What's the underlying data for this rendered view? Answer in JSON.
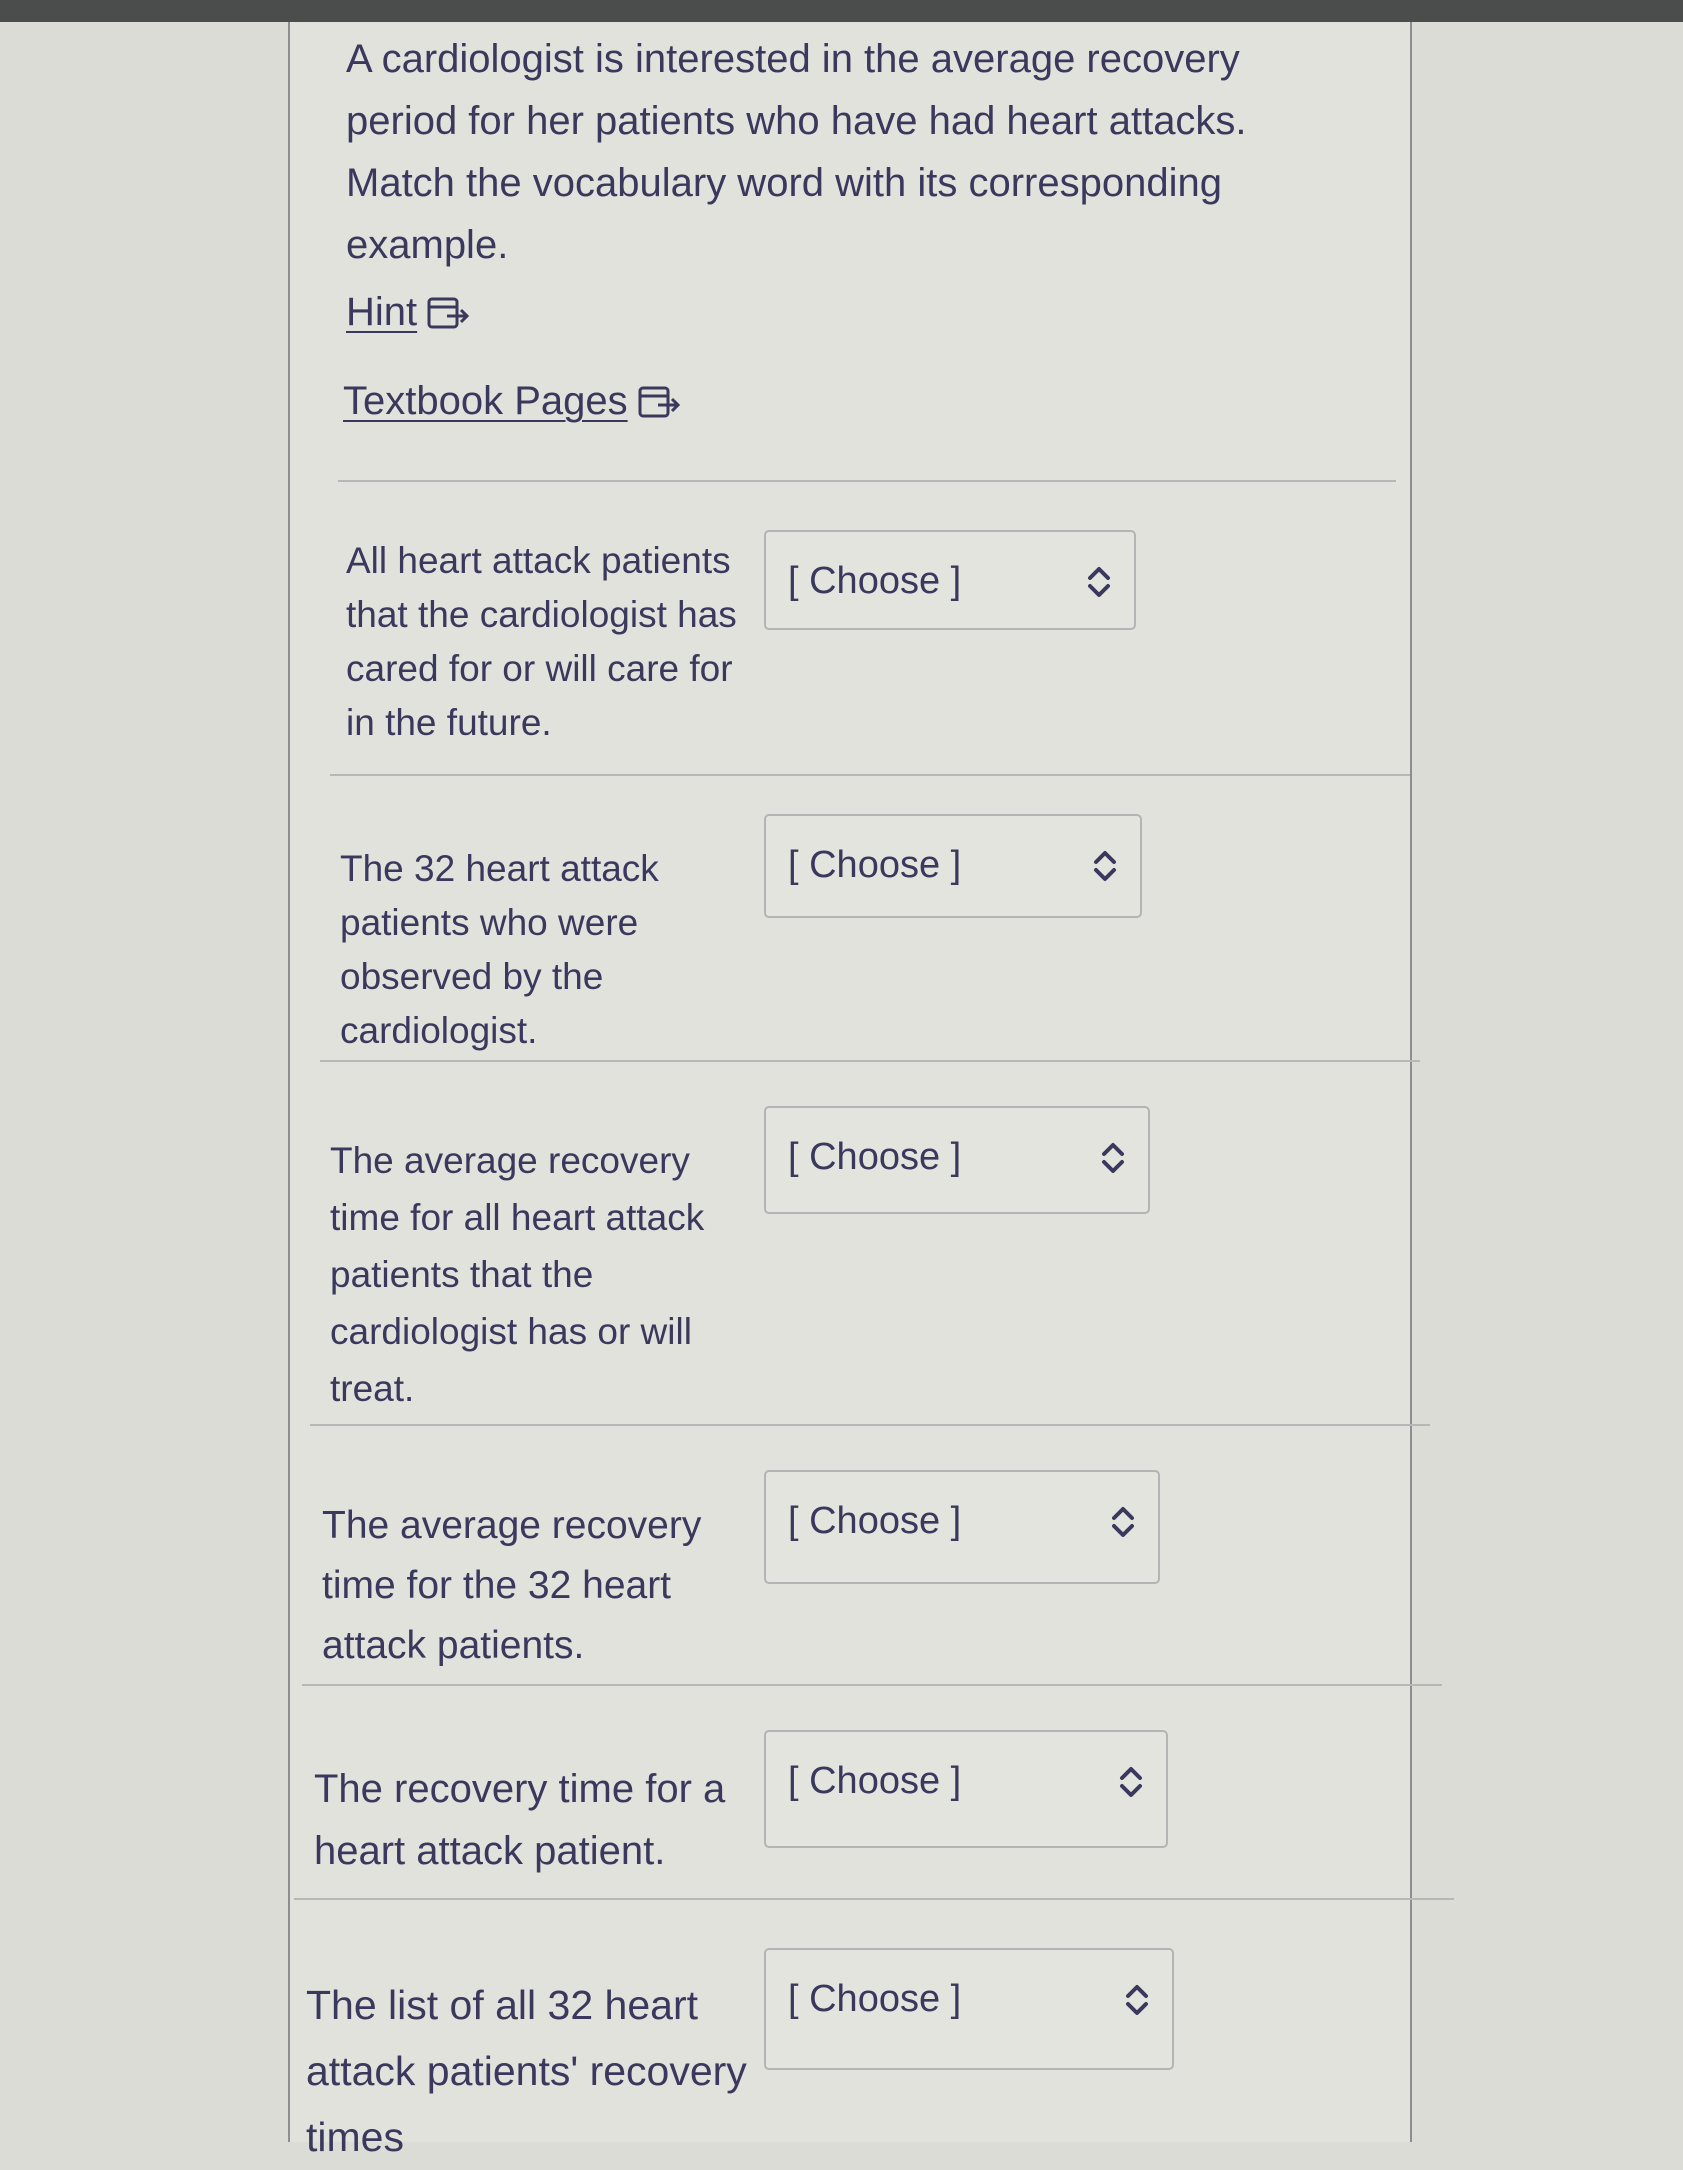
{
  "question": {
    "prompt": "A cardiologist is interested in the average recovery period for her patients who have had heart attacks. Match the vocabulary word with its corresponding example."
  },
  "links": {
    "hint": "Hint",
    "textbook": "Textbook Pages",
    "icon": "external-link-icon"
  },
  "matching": {
    "rows": [
      {
        "label": "All heart attack patients that the cardiologist has cared for or will care for in the future.",
        "selected": "[ Choose ]"
      },
      {
        "label": "The 32 heart attack patients who were observed by the cardiologist.",
        "selected": "[ Choose ]"
      },
      {
        "label": "The average recovery time for all heart attack patients that the cardiologist has or will treat.",
        "selected": "[ Choose ]"
      },
      {
        "label": "The average recovery time for the 32 heart attack patients.",
        "selected": "[ Choose ]"
      },
      {
        "label": "The recovery time for a heart attack patient.",
        "selected": "[ Choose ]"
      },
      {
        "label": "The list of all 32 heart attack patients' recovery times",
        "selected": "[ Choose ]"
      }
    ]
  },
  "colors": {
    "text": "#3a395d",
    "background": "#e2e2dd",
    "border": "#b4b4b4"
  }
}
